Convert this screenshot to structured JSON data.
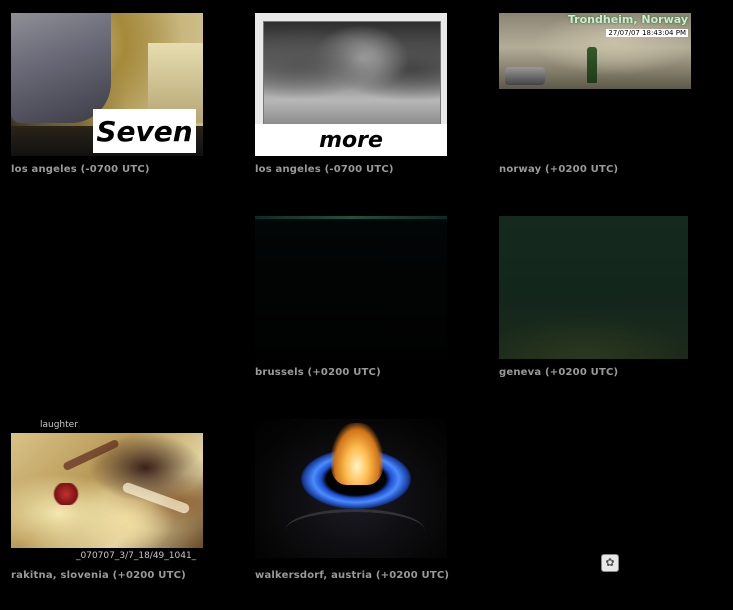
{
  "cams": [
    {
      "caption": "los angeles (-0700 UTC)",
      "overlay": "Seven"
    },
    {
      "caption": "los angeles (-0700 UTC)",
      "overlay": "more"
    },
    {
      "caption": "norway (+0200 UTC)",
      "overlay_city": "Trondheim, Norway",
      "overlay_stamp": "27/07/07 18:43:04 PM"
    },
    {
      "caption": "brussels (+0200 UTC)"
    },
    {
      "caption": "geneva (+0200 UTC)"
    },
    {
      "caption": "rakitna, slovenia (+0200 UTC)",
      "top_label": "laughter",
      "bottom_label": "_070707_3/7_18/49_1041_"
    },
    {
      "caption": "walkersdorf, austria (+0200 UTC)"
    }
  ],
  "reload_icon": "reload-icon"
}
